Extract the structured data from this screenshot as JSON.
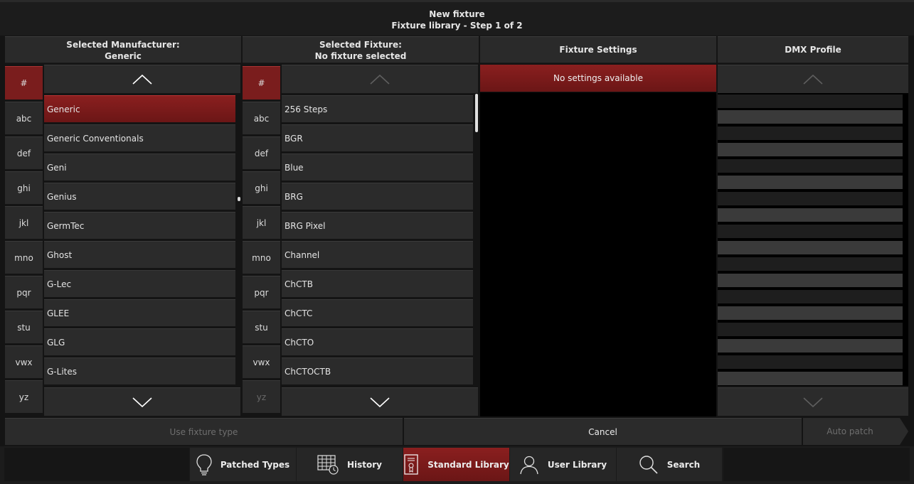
{
  "dialog": {
    "title": "New fixture",
    "subtitle": "Fixture library - Step 1 of 2"
  },
  "columns": {
    "manufacturer": {
      "heading": "Selected Manufacturer:",
      "value": "Generic"
    },
    "fixture": {
      "heading": "Selected Fixture:",
      "value": "No fixture selected"
    },
    "settings": {
      "heading": "Fixture Settings",
      "empty_message": "No settings available"
    },
    "dmx": {
      "heading": "DMX Profile"
    }
  },
  "letter_filters": [
    "#",
    "abc",
    "def",
    "ghi",
    "jkl",
    "mno",
    "pqr",
    "stu",
    "vwx",
    "yz"
  ],
  "manufacturers": [
    "Generic",
    "Generic Conventionals",
    "Geni",
    "Genius",
    "GermTec",
    "Ghost",
    "G-Lec",
    "GLEE",
    "GLG",
    "G-Lites"
  ],
  "fixtures": [
    "256 Steps",
    "BGR",
    "Blue",
    "BRG",
    "BRG Pixel",
    "Channel",
    "ChCTB",
    "ChCTC",
    "ChCTO",
    "ChCTOCTB"
  ],
  "actions": {
    "use_fixture_type": "Use fixture type",
    "cancel": "Cancel",
    "auto_patch": "Auto patch"
  },
  "tabs": [
    {
      "label": "Patched Types",
      "icon": "lightbulb-icon"
    },
    {
      "label": "History",
      "icon": "history-grid-icon"
    },
    {
      "label": "Standard Library",
      "icon": "library-book-icon"
    },
    {
      "label": "User Library",
      "icon": "user-icon"
    },
    {
      "label": "Search",
      "icon": "search-icon"
    }
  ],
  "colors": {
    "accent": "#7a1d1d",
    "background": "#141414",
    "panel": "#2b2b2b"
  }
}
